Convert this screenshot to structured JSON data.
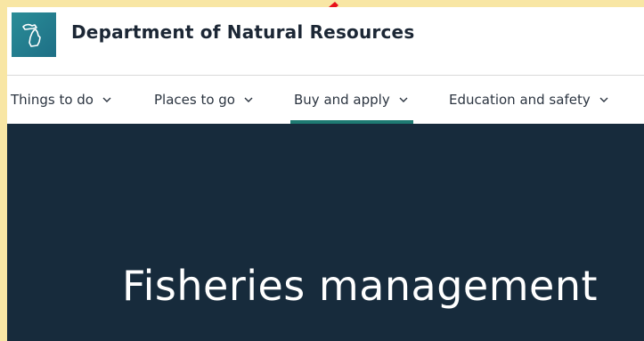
{
  "header": {
    "logo_icon": "michigan-state-icon",
    "title": "Department of Natural Resources"
  },
  "nav": {
    "items": [
      {
        "label": "Things to do",
        "icon": "chevron-down-icon",
        "active": false
      },
      {
        "label": "Places to go",
        "icon": "chevron-down-icon",
        "active": false
      },
      {
        "label": "Buy and apply",
        "icon": "chevron-down-icon",
        "active": true
      },
      {
        "label": "Education and safety",
        "icon": "chevron-down-icon",
        "active": false
      }
    ]
  },
  "hero": {
    "title": "Fisheries management"
  },
  "colors": {
    "frame_border": "#f8e6a4",
    "hero_background": "#172b3c",
    "active_underline": "#1e7a72",
    "logo_background": "#1e6f86",
    "cursor_arrow": "#e8111b"
  }
}
